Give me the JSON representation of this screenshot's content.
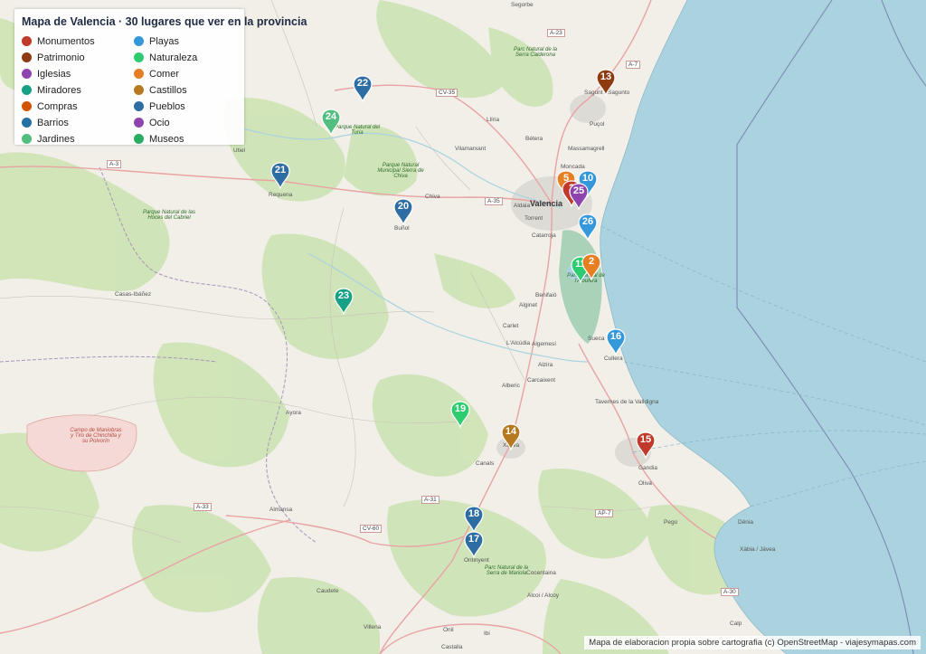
{
  "legend": {
    "title": "Mapa de Valencia · 30 lugares que ver en la provincia",
    "items": [
      {
        "label": "Monumentos",
        "color": "#c0392b"
      },
      {
        "label": "Patrimonio",
        "color": "#8e3b12"
      },
      {
        "label": "Iglesias",
        "color": "#8e44ad"
      },
      {
        "label": "Miradores",
        "color": "#16a085"
      },
      {
        "label": "Compras",
        "color": "#d35400"
      },
      {
        "label": "Barrios",
        "color": "#2471a3"
      },
      {
        "label": "Jardines",
        "color": "#52be80"
      },
      {
        "label": "Playas",
        "color": "#3498db"
      },
      {
        "label": "Naturaleza",
        "color": "#2ecc71"
      },
      {
        "label": "Comer",
        "color": "#e67e22"
      },
      {
        "label": "Castillos",
        "color": "#b7791f"
      },
      {
        "label": "Pueblos",
        "color": "#2e6da4"
      },
      {
        "label": "Ocio",
        "color": "#8e44ad"
      },
      {
        "label": "Museos",
        "color": "#27ae60"
      }
    ]
  },
  "markers": [
    {
      "num": "22",
      "color": "#2e6da4"
    },
    {
      "num": "24",
      "color": "#52be80"
    },
    {
      "num": "21",
      "color": "#2e6da4"
    },
    {
      "num": "20",
      "color": "#2e6da4"
    },
    {
      "num": "23",
      "color": "#16a085"
    },
    {
      "num": "13",
      "color": "#8e3b12"
    },
    {
      "num": "10",
      "color": "#3498db"
    },
    {
      "num": "5",
      "color": "#e67e22"
    },
    {
      "num": "2",
      "color": "#c0392b"
    },
    {
      "num": "25",
      "color": "#8e44ad"
    },
    {
      "num": "26",
      "color": "#3498db"
    },
    {
      "num": "11",
      "color": "#2ecc71"
    },
    {
      "num": "2",
      "color": "#e67e22"
    },
    {
      "num": "16",
      "color": "#3498db"
    },
    {
      "num": "19",
      "color": "#2ecc71"
    },
    {
      "num": "14",
      "color": "#b7791f"
    },
    {
      "num": "15",
      "color": "#c0392b"
    },
    {
      "num": "18",
      "color": "#2e6da4"
    },
    {
      "num": "17",
      "color": "#2e6da4"
    }
  ],
  "places": [
    "Segorbe",
    "Sagunt / Sagunto",
    "Puçol",
    "Massamagrell",
    "Moncada",
    "Bétera",
    "Llíria",
    "Vilamarxant",
    "Utiel",
    "Requena",
    "Chiva",
    "Buñol",
    "Aldaia",
    "Torrent",
    "Catarroja",
    "Benifaió",
    "Alginet",
    "Carlet",
    "L'Alcúdia",
    "Algemesí",
    "Sueca",
    "Cullera",
    "Alzira",
    "Carcaixent",
    "Alberic",
    "Tavernes de la Valldigna",
    "Xàtiva",
    "Canals",
    "Gandia",
    "Oliva",
    "Pego",
    "Dénia",
    "Xàbia / Jávea",
    "Ontinyent",
    "Cocentaina",
    "Alcoi / Alcoy",
    "Ayora",
    "Almansa",
    "Caudete",
    "Villena",
    "Onil",
    "Casas-Ibáñez",
    "Calp",
    "Valencia",
    "Castalla",
    "Ibi"
  ],
  "parks": [
    "Parc Natural de la Serra Calderona",
    "Parque Natural del Turia",
    "Parque Natural Municipal Sierra de Chiva",
    "Parque Natural de las Hoces del Cabriel",
    "Parc Natural de l'Albufera",
    "Campo de Maniobras y Tiro de Chinchilla y su Polvorín",
    "Parc Natural de la Serra de Mariola"
  ],
  "roads": [
    "A-23",
    "A-7",
    "CV-35",
    "A-3",
    "A-35",
    "A-31",
    "A-33",
    "CV-60",
    "AP-7",
    "A-30"
  ],
  "attribution": "Mapa de elaboracion propia sobre cartografia (c) OpenStreetMap - viajesymapas.com"
}
